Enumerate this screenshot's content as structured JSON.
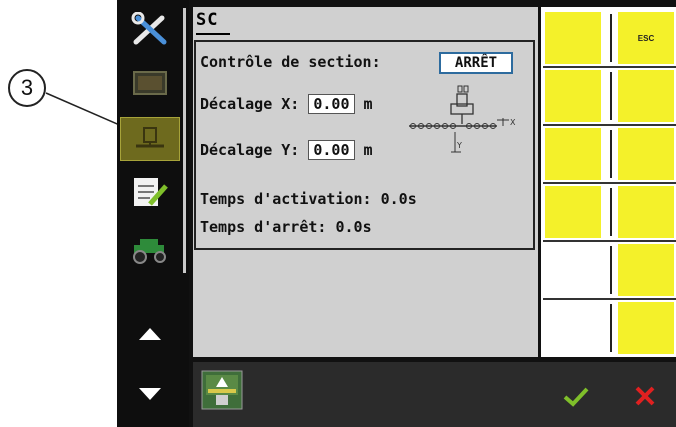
{
  "callout": {
    "number": "3"
  },
  "screen": {
    "title": "SC",
    "section_control": {
      "label": "Contrôle de section:",
      "value": "ARRÊT"
    },
    "offset_x": {
      "label": "Décalage X:",
      "value": "0.00",
      "unit": "m"
    },
    "offset_y": {
      "label": "Décalage Y:",
      "value": "0.00",
      "unit": "m"
    },
    "activation_time": {
      "label": "Temps d'activation:",
      "value": "0.0",
      "unit": "s"
    },
    "stop_time": {
      "label": "Temps d'arrêt:",
      "value": "0.0",
      "unit": "s"
    },
    "diagram": {
      "x_label": "X",
      "y_label": "Y"
    }
  },
  "softkeys": {
    "esc_label": "ESC"
  },
  "sidebar": {
    "items": [
      {
        "icon": "tools-icon"
      },
      {
        "icon": "monitor-icon"
      },
      {
        "icon": "implement-icon"
      },
      {
        "icon": "checklist-icon"
      },
      {
        "icon": "tractor-icon"
      },
      {
        "icon": "arrow-up-icon"
      },
      {
        "icon": "arrow-down-icon"
      }
    ]
  },
  "colors": {
    "softkey": "#f4f12a",
    "confirm": "#7fbf2a",
    "cancel": "#e02020",
    "active": "#6e6a1e"
  }
}
